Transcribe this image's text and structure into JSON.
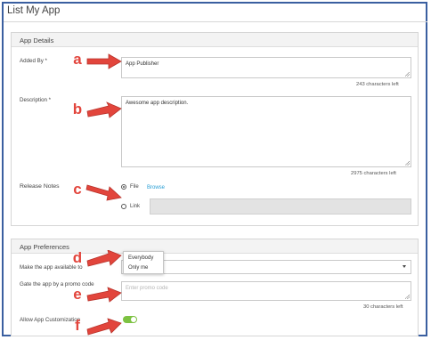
{
  "page": {
    "title": "List My App"
  },
  "app_details": {
    "header": "App Details",
    "added_by": {
      "label": "Added By *",
      "value": "App Publisher",
      "counter": "243 characters left"
    },
    "description": {
      "label": "Description *",
      "value": "Awesome app description.",
      "counter": "2975 characters left"
    },
    "release_notes": {
      "label": "Release Notes",
      "file_option": "File",
      "browse_label": "Browse",
      "link_option": "Link",
      "selected": "File"
    }
  },
  "app_preferences": {
    "header": "App Preferences",
    "availability": {
      "label": "Make the app available to",
      "options": [
        "Everybody",
        "Only me"
      ]
    },
    "promo": {
      "label": "Gate the app by a promo code",
      "placeholder": "Enter promo code",
      "counter": "30 characters left"
    },
    "customization": {
      "label": "Allow App Customization",
      "enabled": true
    }
  },
  "callouts": [
    "a",
    "b",
    "c",
    "d",
    "e",
    "f"
  ],
  "colors": {
    "frame": "#3a5fa0",
    "callout": "#e2453c",
    "toggle_on": "#7dc242",
    "link": "#2a9fd6"
  }
}
